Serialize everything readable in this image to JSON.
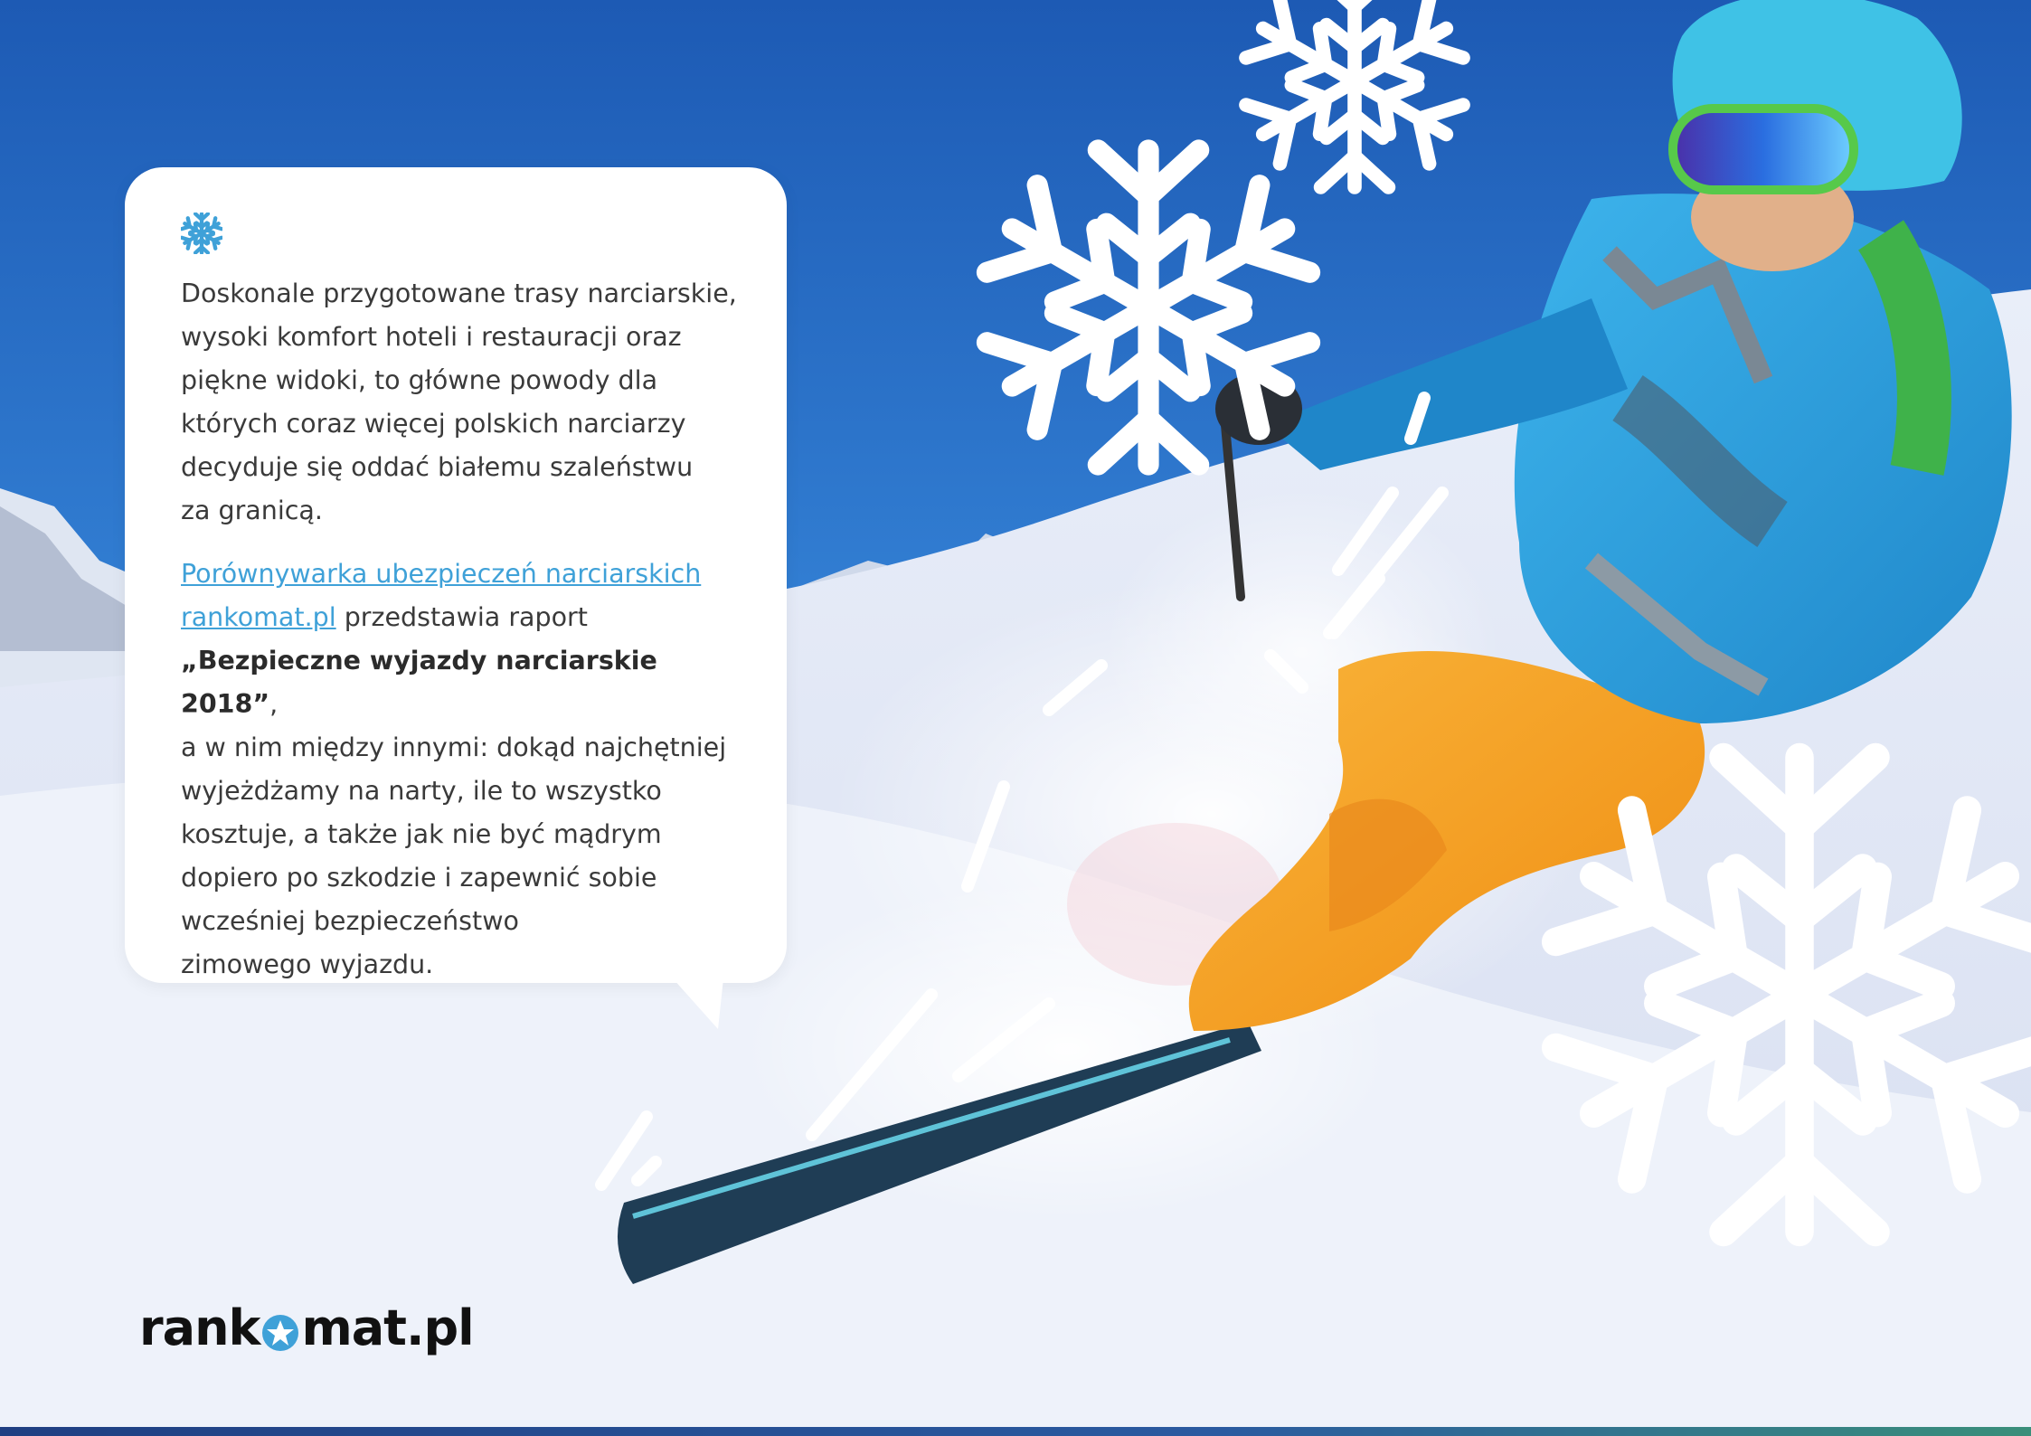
{
  "bubble": {
    "icon": "snowflake-icon",
    "paragraph1_lines": [
      "Doskonale przygotowane trasy narciarskie,",
      "wysoki komfort hoteli i restauracji oraz",
      "piękne widoki, to główne powody dla",
      "których coraz więcej polskich narciarzy",
      "decyduje się oddać białemu szaleństwu",
      "za granicą."
    ],
    "link_line1": "Porównywarka ubezpieczeń narciarskich ",
    "link_line2": "rankomat.pl",
    "after_link": " przedstawia raport",
    "report_title": "„Bezpieczne wyjazdy narciarskie 2018”",
    "report_comma": ",",
    "paragraph2_lines": [
      "a w nim między innymi:  dokąd najchętniej",
      "wyjeżdżamy na narty, ile to wszystko",
      "kosztuje, a także jak nie być mądrym",
      "dopiero po szkodzie i zapewnić sobie",
      "wcześniej bezpieczeństwo",
      "zimowego wyjazdu."
    ]
  },
  "logo": {
    "part1": "rank",
    "part2": "mat.pl"
  },
  "colors": {
    "sky_top": "#1f5fb8",
    "snow": "#f3f5fb",
    "accent_blue": "#3fa1d8",
    "jacket": "#2a9fdc",
    "pants": "#f7a21f"
  }
}
